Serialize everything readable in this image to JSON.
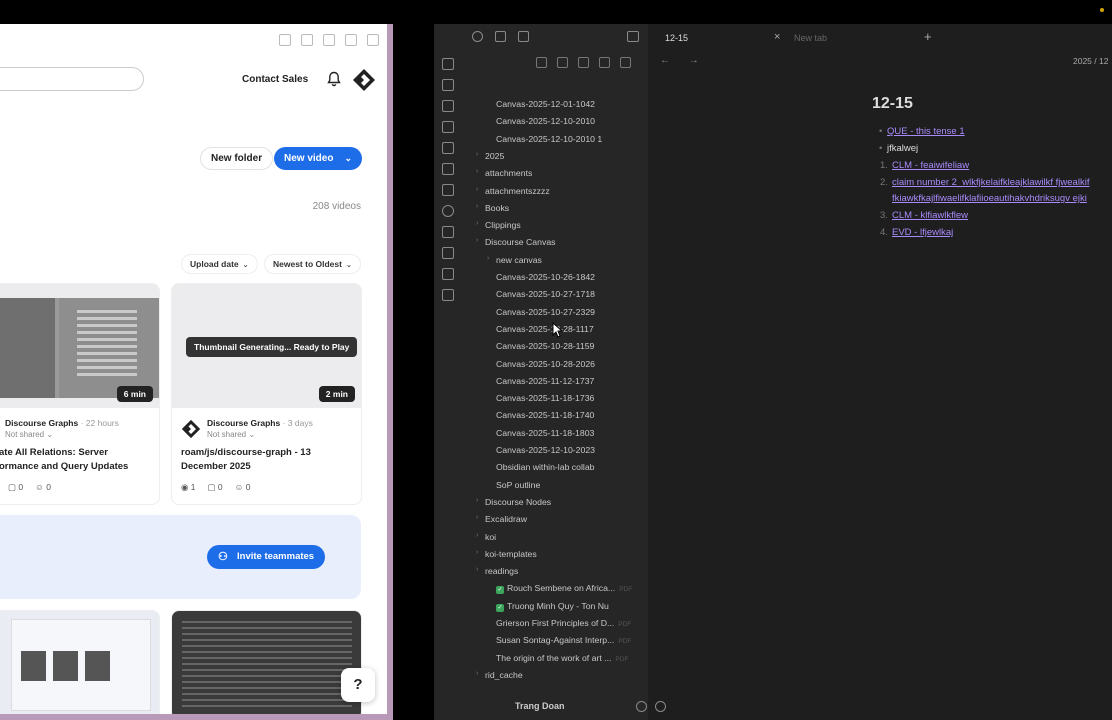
{
  "video_app": {
    "contact_sales": "Contact Sales",
    "new_folder": "New folder",
    "new_video": "New video",
    "video_count": "208 videos",
    "sort_upload": "Upload date",
    "sort_order": "Newest to Oldest",
    "cards": [
      {
        "owner": "Discourse Graphs",
        "time": "· 22 hours",
        "shared": "Not shared ⌄",
        "title_line1": "ate All Relations: Server",
        "title_line2": "ormance and Query Updates",
        "duration": "6 min",
        "comments": "0",
        "reactions": "0"
      },
      {
        "owner": "Discourse Graphs",
        "time": "· 3 days",
        "shared": "Not shared ⌄",
        "title_line1": "roam/js/discourse-graph - 13",
        "title_line2": "December 2025",
        "duration": "2 min",
        "thumb_status": "Thumbnail Generating... Ready to Play",
        "views": "1",
        "comments": "0",
        "reactions": "0"
      }
    ],
    "invite": "Invite teammates",
    "help": "?"
  },
  "obsidian": {
    "tab_active": "12-15",
    "tab_new": "New tab",
    "breadcrumb": "2025 / 12",
    "tree": [
      {
        "label": "Canvas-2025-12-01-1042",
        "indent": 2
      },
      {
        "label": "Canvas-2025-12-10-2010",
        "indent": 2
      },
      {
        "label": "Canvas-2025-12-10-2010 1",
        "indent": 2
      },
      {
        "label": "2025",
        "indent": 1,
        "arrow": true
      },
      {
        "label": "attachments",
        "indent": 1,
        "arrow": true
      },
      {
        "label": "attachmentszzzz",
        "indent": 1,
        "arrow": true
      },
      {
        "label": "Books",
        "indent": 1,
        "arrow": true
      },
      {
        "label": "Clippings",
        "indent": 1,
        "arrow": true
      },
      {
        "label": "Discourse Canvas",
        "indent": 1,
        "arrow": true
      },
      {
        "label": "new canvas",
        "indent": 2,
        "arrow": true
      },
      {
        "label": "Canvas-2025-10-26-1842",
        "indent": 2
      },
      {
        "label": "Canvas-2025-10-27-1718",
        "indent": 2
      },
      {
        "label": "Canvas-2025-10-27-2329",
        "indent": 2
      },
      {
        "label": "Canvas-2025-10-28-1117",
        "indent": 2
      },
      {
        "label": "Canvas-2025-10-28-1159",
        "indent": 2
      },
      {
        "label": "Canvas-2025-10-28-2026",
        "indent": 2
      },
      {
        "label": "Canvas-2025-11-12-1737",
        "indent": 2
      },
      {
        "label": "Canvas-2025-11-18-1736",
        "indent": 2
      },
      {
        "label": "Canvas-2025-11-18-1740",
        "indent": 2
      },
      {
        "label": "Canvas-2025-11-18-1803",
        "indent": 2
      },
      {
        "label": "Canvas-2025-12-10-2023",
        "indent": 2
      },
      {
        "label": "Obsidian within-lab collab",
        "indent": 2
      },
      {
        "label": "SoP outline",
        "indent": 2
      },
      {
        "label": "Discourse Nodes",
        "indent": 1,
        "arrow": true
      },
      {
        "label": "Excalidraw",
        "indent": 1,
        "arrow": true
      },
      {
        "label": "koi",
        "indent": 1,
        "arrow": true
      },
      {
        "label": "koi-templates",
        "indent": 1,
        "arrow": true
      },
      {
        "label": "readings",
        "indent": 1,
        "arrow": true
      },
      {
        "label": "Rouch Sembene on Africa...",
        "indent": 2,
        "check": true,
        "ext": "PDF"
      },
      {
        "label": "Truong Minh Quy - Ton Nu",
        "indent": 2,
        "check": true
      },
      {
        "label": "Grierson First Principles of D...",
        "indent": 2,
        "ext": "PDF"
      },
      {
        "label": "Susan Sontag-Against Interp...",
        "indent": 2,
        "ext": "PDF"
      },
      {
        "label": "The origin of the work of art ...",
        "indent": 2,
        "ext": "PDF"
      },
      {
        "label": "rid_cache",
        "indent": 1,
        "arrow": true
      }
    ],
    "vault_user": "Trang Doan",
    "note": {
      "title": "12-15",
      "line1": "QUE - this tense 1",
      "line2": "jfkalwej",
      "item1": "CLM - feaiwifeliaw",
      "item2a": "claim number 2_wlkfjkelaifkleajklawilkf fjwealkif",
      "item2b": "fkiawkfkajlfiwaelifklafiioeautihakvhdriksugv ejki",
      "item3": "CLM - klfiawlkflew",
      "item4": "EVD - lfjewlkaj",
      "n1": "1.",
      "n2": "2.",
      "n3": "3.",
      "n4": "4."
    }
  }
}
